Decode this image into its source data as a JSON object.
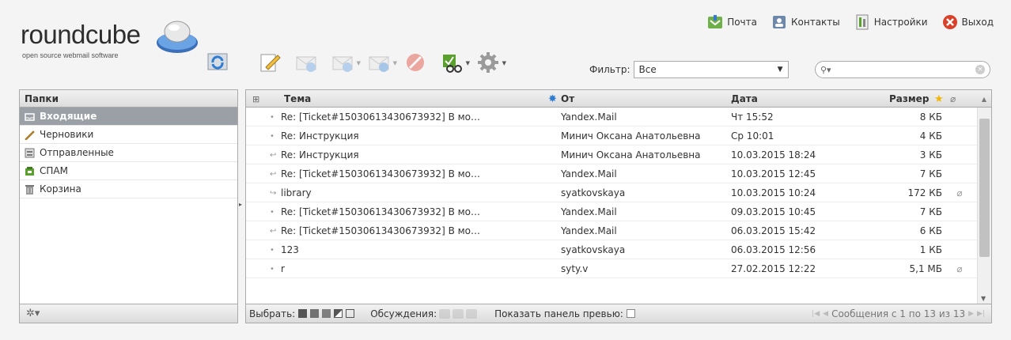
{
  "logo": {
    "wordmark": "roundcube",
    "tagline": "open source webmail software"
  },
  "topnav": [
    {
      "label": "Почта",
      "icon": "mail-icon"
    },
    {
      "label": "Контакты",
      "icon": "contacts-icon"
    },
    {
      "label": "Настройки",
      "icon": "settings-icon"
    },
    {
      "label": "Выход",
      "icon": "logout-icon"
    }
  ],
  "filter": {
    "label": "Фильтр:",
    "value": "Все"
  },
  "folders": {
    "header": "Папки",
    "items": [
      {
        "label": "Входящие",
        "selected": true
      },
      {
        "label": "Черновики"
      },
      {
        "label": "Отправленные"
      },
      {
        "label": "СПАМ"
      },
      {
        "label": "Корзина"
      }
    ]
  },
  "mail": {
    "columns": {
      "subject": "Тема",
      "from": "От",
      "date": "Дата",
      "size": "Размер"
    },
    "rows": [
      {
        "subject": "Re: [Ticket#15030613430673932] В мо…",
        "from": "Yandex.Mail",
        "date": "Чт 15:52",
        "size": "8 КБ",
        "status": "•",
        "attach": false
      },
      {
        "subject": "Re: Инструкция",
        "from": "Минич Оксана Анатольевна",
        "date": "Ср 10:01",
        "size": "4 КБ",
        "status": "•",
        "attach": false
      },
      {
        "subject": "Re: Инструкция",
        "from": "Минич Оксана Анатольевна",
        "date": "10.03.2015 18:24",
        "size": "3 КБ",
        "status": "↩",
        "attach": false
      },
      {
        "subject": "Re: [Ticket#15030613430673932] В мо…",
        "from": "Yandex.Mail",
        "date": "10.03.2015 12:45",
        "size": "7 КБ",
        "status": "↩",
        "attach": false
      },
      {
        "subject": "library",
        "from": "syatkovskaya",
        "date": "10.03.2015 10:24",
        "size": "172 КБ",
        "status": "↪",
        "attach": true
      },
      {
        "subject": "Re: [Ticket#15030613430673932] В мо…",
        "from": "Yandex.Mail",
        "date": "09.03.2015 10:45",
        "size": "7 КБ",
        "status": "•",
        "attach": false
      },
      {
        "subject": "Re: [Ticket#15030613430673932] В мо…",
        "from": "Yandex.Mail",
        "date": "06.03.2015 15:42",
        "size": "6 КБ",
        "status": "↩",
        "attach": false
      },
      {
        "subject": "123",
        "from": "syatkovskaya",
        "date": "06.03.2015 12:56",
        "size": "1 КБ",
        "status": "•",
        "attach": false
      },
      {
        "subject": "r",
        "from": "syty.v",
        "date": "27.02.2015 12:22",
        "size": "5,1 МБ",
        "status": "•",
        "attach": true
      }
    ],
    "footer": {
      "select_label": "Выбрать:",
      "threads_label": "Обсуждения:",
      "preview_label": "Показать панель превью:",
      "pager_text": "Сообщения с 1 по 13 из 13"
    }
  },
  "colors": {
    "selected_folder_bg": "#9aa0a6",
    "accent_green": "#5aa02c",
    "logout_red": "#d9412b"
  }
}
